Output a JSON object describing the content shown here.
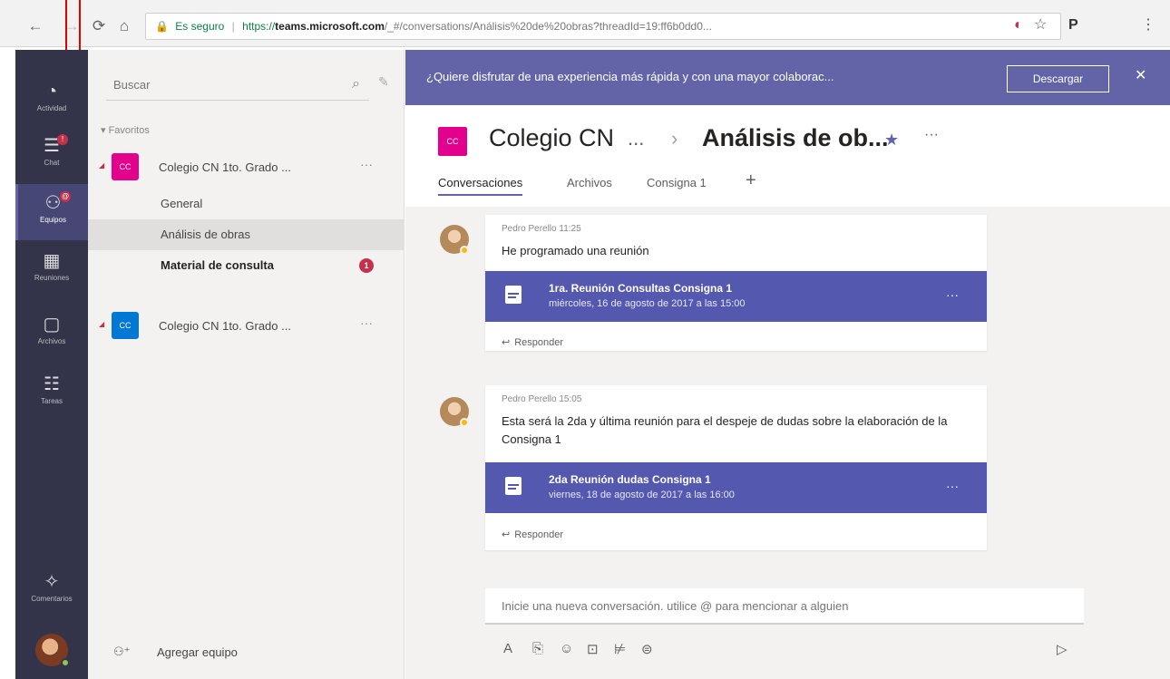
{
  "browser": {
    "back": "←",
    "forward": "→",
    "reload": "⟳",
    "home": "⌂",
    "lock": "🔒",
    "secure": "Es seguro",
    "url_scheme": "https://",
    "url_host": "teams.microsoft.com",
    "url_path": "/_#/conversations/Análisis%20de%20obras?threadId=19:ff6b0dd0...",
    "ext1": "◐",
    "star": "☆",
    "ext2": "P",
    "menu": "⋮"
  },
  "rail": {
    "items": [
      {
        "icon": "◔",
        "label": "Actividad"
      },
      {
        "icon": "☰",
        "label": "Chat",
        "badge": "!"
      },
      {
        "icon": "⚇",
        "label": "Equipos",
        "badge": "@"
      },
      {
        "icon": "▦",
        "label": "Reuniones"
      },
      {
        "icon": "▢",
        "label": "Archivos"
      },
      {
        "icon": "☷",
        "label": "Tareas"
      }
    ],
    "community": {
      "icon": "✧",
      "label": "Comentarios"
    }
  },
  "teams": {
    "search_placeholder": "Buscar",
    "section": "Favoritos",
    "list": [
      {
        "avatar": "CC",
        "name": "Colegio CN   1to. Grado ...",
        "color": "#e3008c"
      },
      {
        "avatar": "CC",
        "name": "Colegio CN   1to. Grado ...",
        "color": "#0078d4"
      }
    ],
    "channels": [
      "General",
      "Análisis de obras",
      "Material de consulta"
    ],
    "channel_badge": "1",
    "add_team": "Agregar equipo"
  },
  "banner": {
    "text": "¿Quiere disfrutar de una experiencia más rápida y con una mayor colaborac...",
    "button": "Descargar",
    "close": "✕"
  },
  "header": {
    "team": "Colegio CN",
    "ellipsis": "...",
    "chevron": "›",
    "channel": "Análisis de ob...",
    "star": "★",
    "more": "···",
    "tabs": [
      "Conversaciones",
      "Archivos",
      "Consigna 1"
    ],
    "tab_add": "+"
  },
  "messages": [
    {
      "author": "Pedro Perello",
      "time": "11:25",
      "text": "He programado una reunión",
      "event_title": "1ra. Reunión Consultas Consigna 1",
      "event_date": "miércoles, 16 de agosto de 2017 a las 15:00",
      "reply": "Responder"
    },
    {
      "author": "Pedro Perello",
      "time": "15:05",
      "text": "Esta será la 2da y última reunión para el despeje de dudas sobre la elaboración de la Consigna 1",
      "event_title": "2da Reunión dudas Consigna 1",
      "event_date": "viernes, 18 de agosto de 2017 a las 16:00",
      "reply": "Responder"
    }
  ],
  "compose": {
    "placeholder": "Inicie una nueva conversación. utilice @ para mencionar a alguien",
    "tools": [
      "A",
      "⎘",
      "☺",
      "⊡",
      "⊭",
      "⊜"
    ],
    "send": "▷"
  },
  "colors": {
    "rail": "#33344a",
    "brand": "#6264a7",
    "event": "#5558af",
    "badge": "#c4314b"
  }
}
